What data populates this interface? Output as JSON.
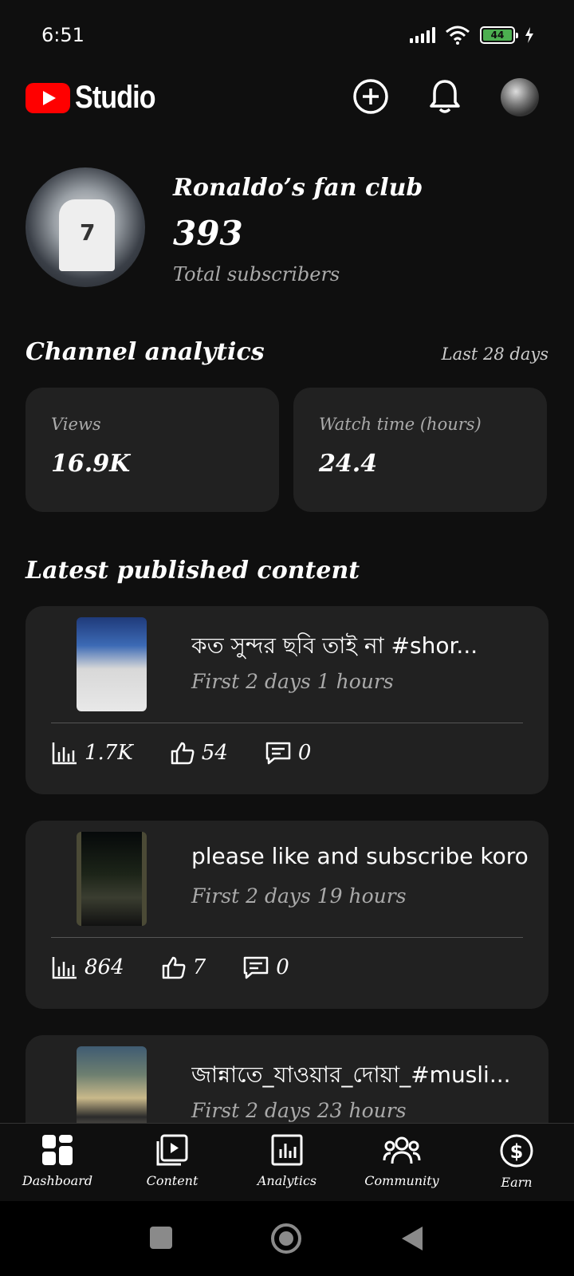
{
  "status_bar": {
    "time": "6:51",
    "battery": "44"
  },
  "header": {
    "logo_text": "Studio",
    "icons": [
      "create-icon",
      "bell-icon",
      "account-avatar"
    ]
  },
  "channel": {
    "name": "Ronaldo’s fan club",
    "subscribers": "393",
    "subscribers_label": "Total subscribers"
  },
  "analytics": {
    "title": "Channel analytics",
    "period": "Last 28 days",
    "metrics": [
      {
        "label": "Views",
        "value": "16.9K"
      },
      {
        "label": "Watch time (hours)",
        "value": "24.4"
      }
    ]
  },
  "latest": {
    "title": "Latest published content",
    "items": [
      {
        "title": "কত সুন্দর ছবি তাই না #shor...",
        "subtitle": "First 2 days 1 hours",
        "views": "1.7K",
        "likes": "54",
        "comments": "0"
      },
      {
        "title": "please like and subscribe koro",
        "subtitle": "First 2 days 19 hours",
        "views": "864",
        "likes": "7",
        "comments": "0"
      },
      {
        "title": "জান্নাতে_যাওয়ার_দোয়া_#musli...",
        "subtitle": "First 2 days 23 hours"
      }
    ]
  },
  "bottom_nav": [
    {
      "label": "Dashboard",
      "icon": "dashboard-icon"
    },
    {
      "label": "Content",
      "icon": "content-icon"
    },
    {
      "label": "Analytics",
      "icon": "analytics-icon"
    },
    {
      "label": "Community",
      "icon": "community-icon"
    },
    {
      "label": "Earn",
      "icon": "earn-icon"
    }
  ],
  "colors": {
    "background": "#0f0f0f",
    "card": "#212121",
    "brand_red": "#ff0000",
    "battery_green": "#4caf50"
  }
}
